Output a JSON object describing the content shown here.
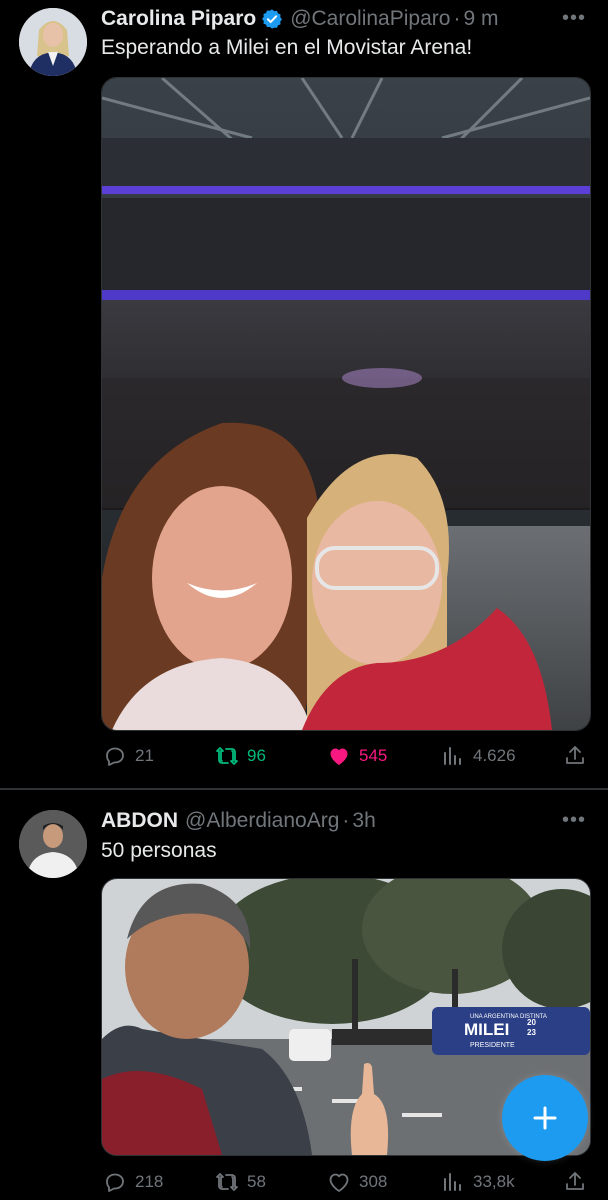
{
  "colors": {
    "background": "#000000",
    "text_primary": "#e7e9ea",
    "text_secondary": "#71767b",
    "verified_blue": "#1d9bf0",
    "retweet_green": "#00ba7c",
    "like_pink": "#f91880",
    "fab_blue": "#1d9bf0"
  },
  "tweets": [
    {
      "avatar": "avatar-photo",
      "author_name": "Carolina Piparo",
      "verified": true,
      "verified_icon": "verified-badge-icon",
      "handle": "@CarolinaPiparo",
      "separator": "·",
      "time": "9 m",
      "more_icon": "more-options-icon",
      "text": "Esperando a Milei en el Movistar Arena!",
      "media": "photo",
      "actions": {
        "reply_icon": "reply-icon",
        "replies": "21",
        "retweet_icon": "retweet-icon",
        "retweets": "96",
        "retweeted": true,
        "like_icon": "heart-filled-icon",
        "likes": "545",
        "liked": true,
        "views_icon": "views-icon",
        "views": "4.626",
        "share_icon": "share-icon"
      }
    },
    {
      "avatar": "avatar-photo",
      "author_name": "ABDON",
      "verified": false,
      "handle": "@AlberdianoArg",
      "separator": "·",
      "time": "3h",
      "more_icon": "more-options-icon",
      "text": "50 personas",
      "media": "photo",
      "media_caption": {
        "bus_small": "UNA ARGENTINA DISTINTA",
        "bus_big": "MILEI",
        "bus_year_top": "20",
        "bus_year_bottom": "23",
        "bus_sub": "PRESIDENTE"
      },
      "actions": {
        "reply_icon": "reply-icon",
        "replies": "218",
        "retweet_icon": "retweet-icon",
        "retweets": "58",
        "retweeted": false,
        "like_icon": "heart-outline-icon",
        "likes": "308",
        "liked": false,
        "views_icon": "views-icon",
        "views": "33,8k",
        "share_icon": "share-icon"
      }
    }
  ],
  "fab": {
    "icon": "plus-icon",
    "action": "compose"
  }
}
